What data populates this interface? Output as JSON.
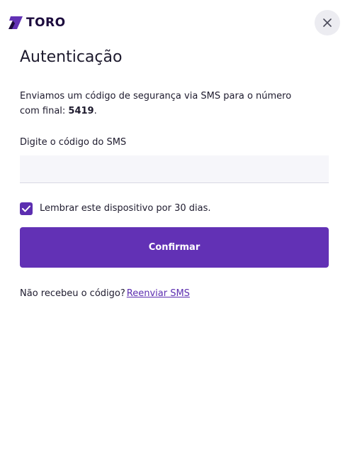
{
  "brand": {
    "name": "TORO",
    "color": "#1c0b3d",
    "accent": "#6231b5"
  },
  "header": {
    "close_icon": "close-icon"
  },
  "auth": {
    "title": "Autenticação",
    "description_prefix": "Enviamos um código de segurança via SMS para o número com final: ",
    "phone_suffix": "5419",
    "description_end": ".",
    "code_label": "Digite o código do SMS",
    "code_value": "",
    "remember_checked": true,
    "remember_label": "Lembrar este dispositivo por 30 dias.",
    "confirm_label": "Confirmar",
    "resend_prompt": "Não recebeu o código?",
    "resend_link": "Reenviar SMS"
  }
}
